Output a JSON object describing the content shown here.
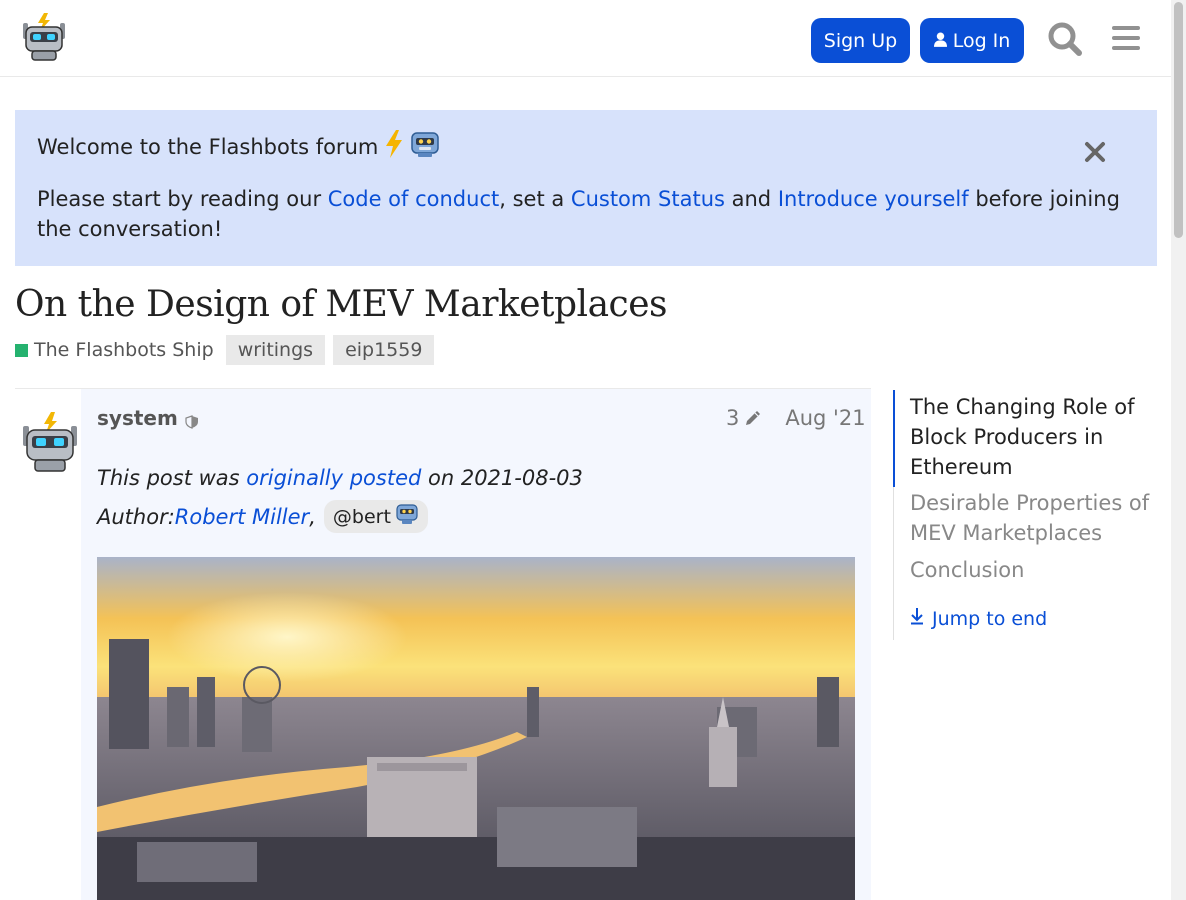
{
  "header": {
    "logo": "flashbots-robot-logo",
    "signup_label": "Sign Up",
    "login_label": "Log In",
    "icons": [
      "user-icon",
      "search-icon",
      "hamburger-menu-icon"
    ]
  },
  "banner": {
    "title": "Welcome to the Flashbots forum",
    "title_emoji": [
      "lightning-emoji",
      "robot-emoji"
    ],
    "text_before_link1": "Please start by reading our ",
    "link1": "Code of conduct",
    "text_between_1_2": ", set a ",
    "link2": "Custom Status",
    "text_between_2_3": " and ",
    "link3": "Introduce yourself",
    "text_after": " before joining the conversation!"
  },
  "topic": {
    "title": "On the Design of MEV Marketplaces",
    "category": "The Flashbots Ship",
    "tags": [
      "writings",
      "eip1559"
    ]
  },
  "post": {
    "author": "system",
    "edit_count": "3",
    "date": "Aug '21",
    "line1_prefix": "This post was ",
    "line1_link": "originally posted",
    "line1_suffix": " on 2021-08-03",
    "line2_prefix": "Author: ",
    "line2_link": "Robert Miller",
    "line2_sep": ",",
    "mention": "@bert",
    "image": "london-skyline-sunset-photo"
  },
  "timeline": {
    "items": [
      "The Changing Role of Block Producers in Ethereum",
      "Desirable Properties of MEV Marketplaces",
      "Conclusion"
    ],
    "jump_label": "Jump to end"
  },
  "colors": {
    "accent": "#0a4fd6",
    "banner_bg": "#d7e2fb",
    "category": "#25b26f",
    "post_bg": "#f4f7fe"
  }
}
